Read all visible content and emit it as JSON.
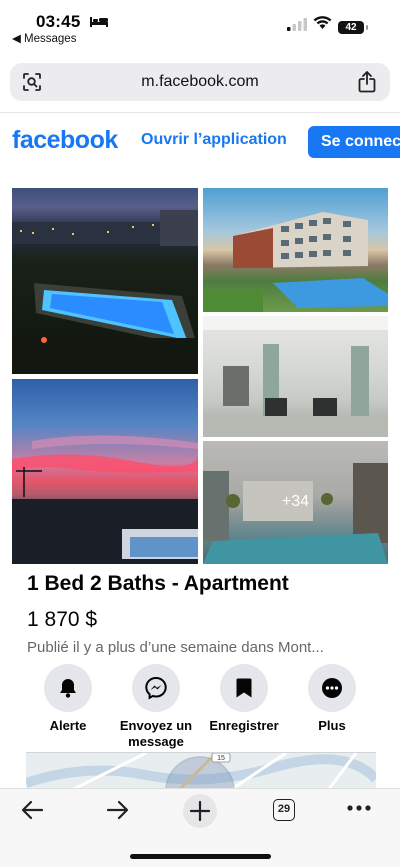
{
  "status": {
    "time": "03:45",
    "back_label": "◀ Messages",
    "battery": "42"
  },
  "browser": {
    "url": "m.facebook.com",
    "tabs_count": "29"
  },
  "header": {
    "logo": "facebook",
    "open_app": "Ouvrir l’application",
    "login": "Se connecter"
  },
  "gallery": {
    "more_count": "+34"
  },
  "listing": {
    "title": "1 Bed 2 Baths - Apartment",
    "price": "1 870 $",
    "posted": "Publié il y a plus d’une semaine dans Mont..."
  },
  "actions": [
    {
      "label": "Alerte",
      "icon": "bell-icon"
    },
    {
      "label": "Envoyez un message",
      "icon": "messenger-icon"
    },
    {
      "label": "Enregistrer",
      "icon": "bookmark-icon"
    },
    {
      "label": "Plus",
      "icon": "more-dots-icon"
    }
  ],
  "map": {
    "route_label": "15"
  },
  "colors": {
    "brand": "#1877f2",
    "secondary_text": "#65676b",
    "button_bg": "#e4e6eb"
  }
}
